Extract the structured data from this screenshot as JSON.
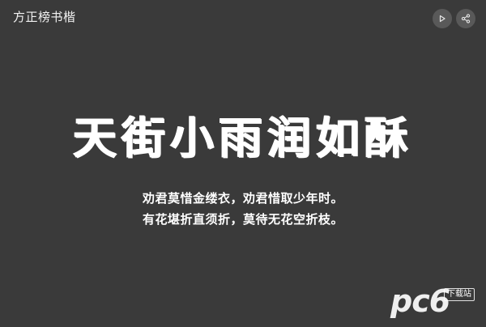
{
  "header": {
    "title": "方正榜书楷"
  },
  "controls": {
    "play_icon": "play-icon",
    "share_icon": "share-icon"
  },
  "preview": {
    "headline": "天街小雨润如酥",
    "poem_line_1": "劝君莫惜金缕衣，劝君惜取少年时。",
    "poem_line_2": "有花堪折直须折，莫待无花空折枝。"
  },
  "watermark": {
    "logo_text": "pc6",
    "badge": "下载站"
  },
  "colors": {
    "background": "#3a3a3a",
    "button_bg": "#595959",
    "text": "#ffffff"
  }
}
